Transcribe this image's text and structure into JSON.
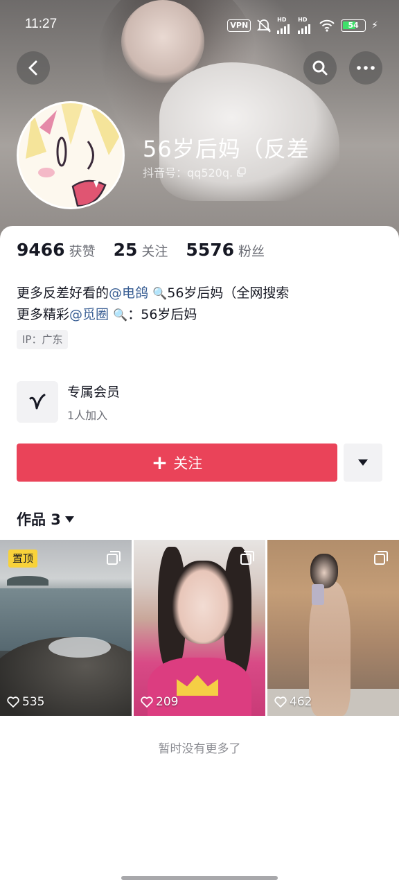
{
  "status_bar": {
    "time": "11:27",
    "vpn": "VPN",
    "hd1": "HD",
    "hd2": "HD",
    "battery": "54"
  },
  "header": {
    "nickname": "56岁后妈（反差",
    "douyin_id": "抖音号：qq520q."
  },
  "stats": [
    {
      "num": "9466",
      "label": "获赞"
    },
    {
      "num": "25",
      "label": "关注"
    },
    {
      "num": "5576",
      "label": "粉丝"
    }
  ],
  "bio": {
    "line1_pre": "更多反差好看的",
    "line1_mention": "@电鸽",
    "line1_post": "56岁后妈（全网搜索",
    "line2_pre": "更多精彩",
    "line2_mention": "@觅圈",
    "line2_post": "：56岁后妈"
  },
  "ip_tag": "IP：广东",
  "member": {
    "title": "专属会员",
    "subtitle": "1人加入"
  },
  "follow_button": "关注",
  "works_tab": "作品 3",
  "videos": [
    {
      "likes": "535",
      "pinned": "置顶"
    },
    {
      "likes": "209"
    },
    {
      "likes": "462"
    }
  ],
  "no_more": "暂时没有更多了",
  "colors": {
    "accent": "#ea4359",
    "mention": "#3a5f94",
    "pin": "#f8d23a"
  }
}
